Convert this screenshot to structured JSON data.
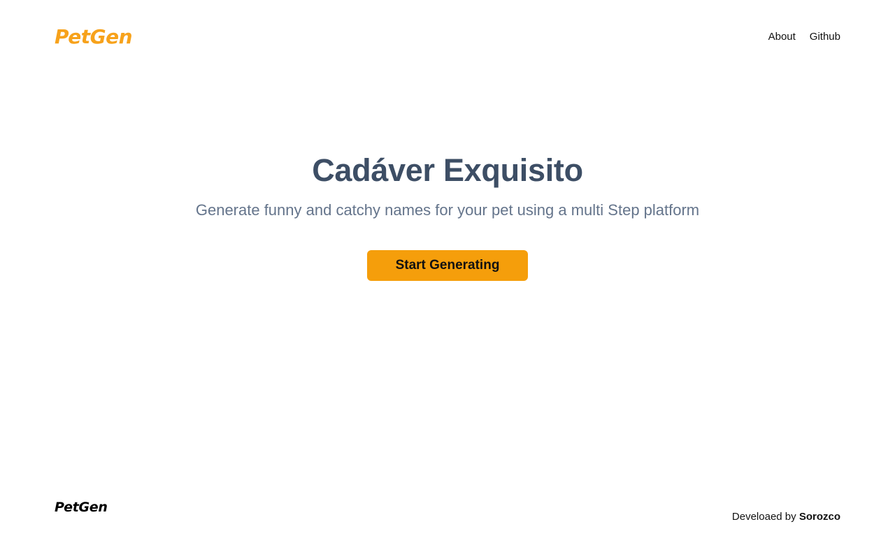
{
  "header": {
    "logo": "PetGen",
    "nav": [
      {
        "label": "About"
      },
      {
        "label": "Github"
      }
    ]
  },
  "hero": {
    "title": "Cadáver Exquisito",
    "subtitle": "Generate funny and catchy names for your pet using a multi Step platform",
    "cta_label": "Start Generating"
  },
  "footer": {
    "logo": "PetGen",
    "credit_prefix": "Develoaed by",
    "credit_name": "Sorozco"
  },
  "colors": {
    "brand": "#f7a21b",
    "button": "#f59e0b",
    "title": "#3d4e65",
    "subtitle": "#64748b"
  }
}
